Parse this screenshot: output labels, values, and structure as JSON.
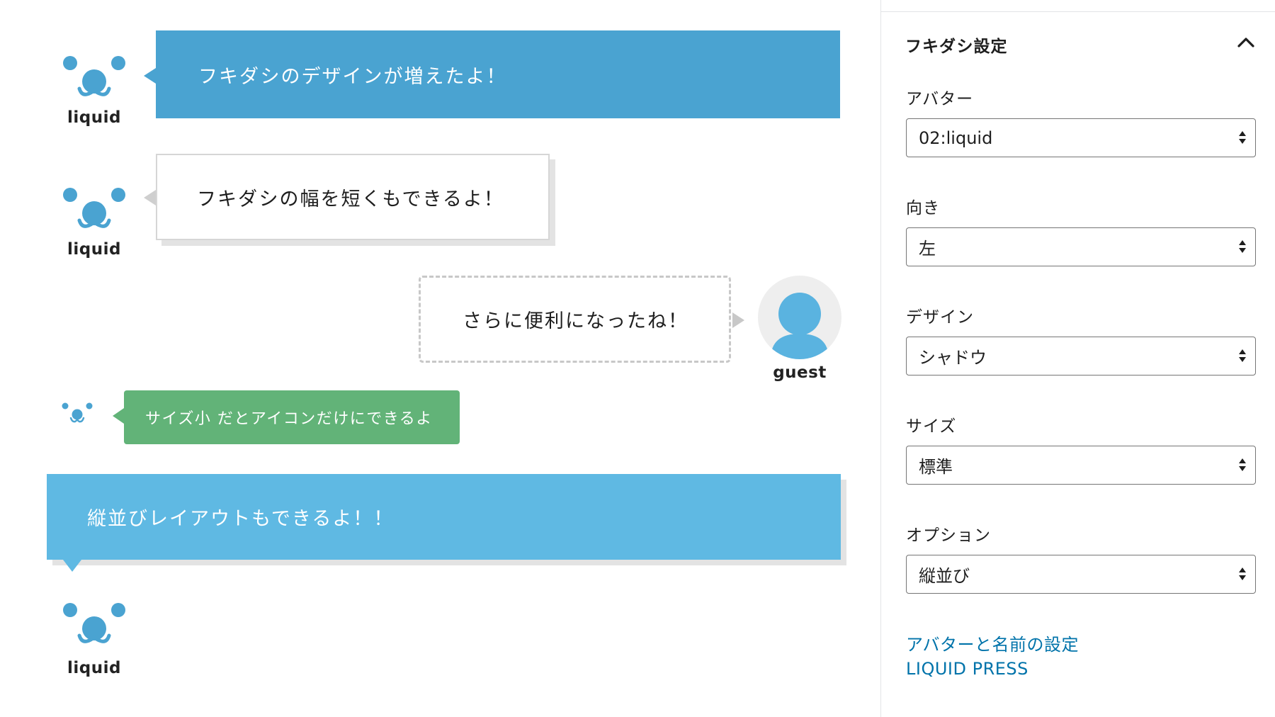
{
  "colors": {
    "accent_blue": "#4aa3d1",
    "light_blue": "#5fb9e3",
    "green": "#62b378",
    "bear_blue": "#4aa3d1",
    "guest_blue": "#5ab3e0",
    "link": "#0073aa"
  },
  "bubbles": [
    {
      "text": "フキダシのデザインが増えたよ！",
      "avatar": "liquid"
    },
    {
      "text": "フキダシの幅を短くもできるよ！",
      "avatar": "liquid"
    },
    {
      "text": "さらに便利になったね！",
      "avatar": "guest"
    },
    {
      "text": "サイズ小 だとアイコンだけにできるよ"
    },
    {
      "text": "縦並びレイアウトもできるよ！！",
      "avatar": "liquid"
    }
  ],
  "sidebar": {
    "panel_title": "フキダシ設定",
    "toggle_icon": "chevron-up-icon",
    "fields": [
      {
        "label": "アバター",
        "value": "02:liquid"
      },
      {
        "label": "向き",
        "value": "左"
      },
      {
        "label": "デザイン",
        "value": "シャドウ"
      },
      {
        "label": "サイズ",
        "value": "標準"
      },
      {
        "label": "オプション",
        "value": "縦並び"
      }
    ],
    "links": [
      "アバターと名前の設定",
      "LIQUID PRESS"
    ]
  }
}
